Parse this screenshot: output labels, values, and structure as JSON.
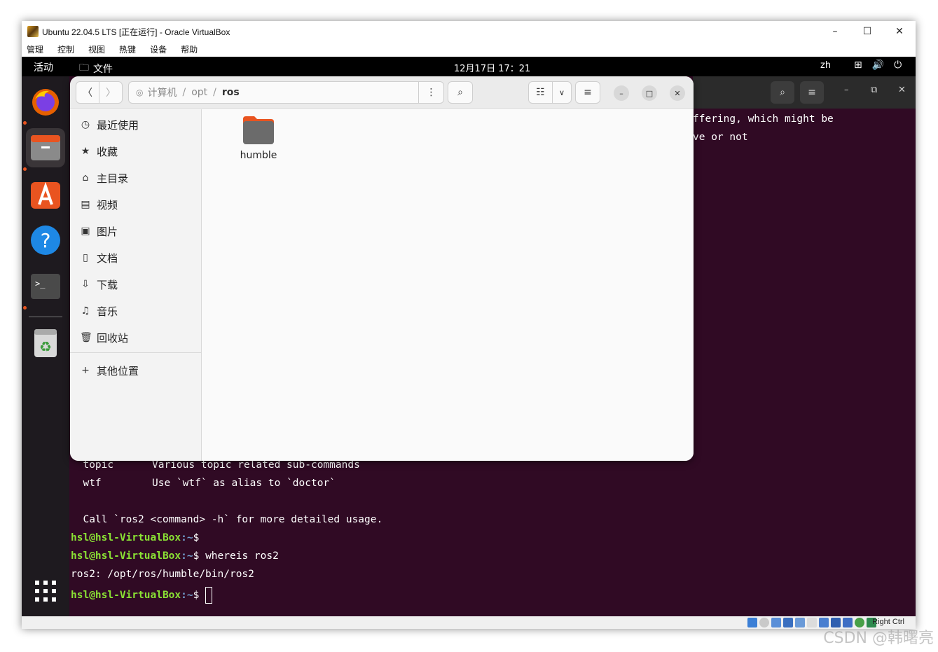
{
  "vbox": {
    "title": "Ubuntu 22.04.5 LTS [正在运行] - Oracle VirtualBox",
    "menus": [
      "管理",
      "控制",
      "视图",
      "热键",
      "设备",
      "帮助"
    ],
    "controls": {
      "minimize": "–",
      "maximize": "☐",
      "close": "✕"
    },
    "status_right": "Right Ctrl"
  },
  "topbar": {
    "activities": "活动",
    "app_name": "文件",
    "clock": "12月17日  17：21",
    "lang": "zh"
  },
  "files": {
    "path": [
      "计算机",
      "opt",
      "ros"
    ],
    "sidebar": [
      {
        "label": "最近使用",
        "icon": "clock-icon",
        "glyph": "◷"
      },
      {
        "label": "收藏",
        "icon": "star-icon",
        "glyph": "★"
      },
      {
        "label": "主目录",
        "icon": "home-icon",
        "glyph": "⌂"
      },
      {
        "label": "视频",
        "icon": "video-icon",
        "glyph": "▤"
      },
      {
        "label": "图片",
        "icon": "picture-icon",
        "glyph": "▣"
      },
      {
        "label": "文档",
        "icon": "document-icon",
        "glyph": "▯"
      },
      {
        "label": "下载",
        "icon": "download-icon",
        "glyph": "⇩"
      },
      {
        "label": "音乐",
        "icon": "music-icon",
        "glyph": "♫"
      },
      {
        "label": "回收站",
        "icon": "trash-icon",
        "glyph": "🗑"
      }
    ],
    "other_locations": "其他位置",
    "items": [
      {
        "name": "humble"
      }
    ]
  },
  "terminal": {
    "partial_top_1": "ffering, which might be",
    "partial_top_2": "ve or not",
    "rows": [
      {
        "cmd": "  topic",
        "desc": "Various topic related sub-commands"
      },
      {
        "cmd": "  wtf",
        "desc": "Use `wtf` as alias to `doctor`"
      }
    ],
    "usage": "  Call `ros2 <command> -h` for more detailed usage.",
    "prompt_user": "hsl@hsl-VirtualBox",
    "prompt_path": ":~",
    "prompt_symbol": "$",
    "command": " whereis ros2",
    "output": "ros2: /opt/ros/humble/bin/ros2"
  },
  "watermark": "CSDN @韩曙亮",
  "colors": {
    "terminal_bg": "#300a24",
    "prompt_green": "#8ae234",
    "prompt_blue": "#729fcf",
    "accent": "#e95420"
  }
}
